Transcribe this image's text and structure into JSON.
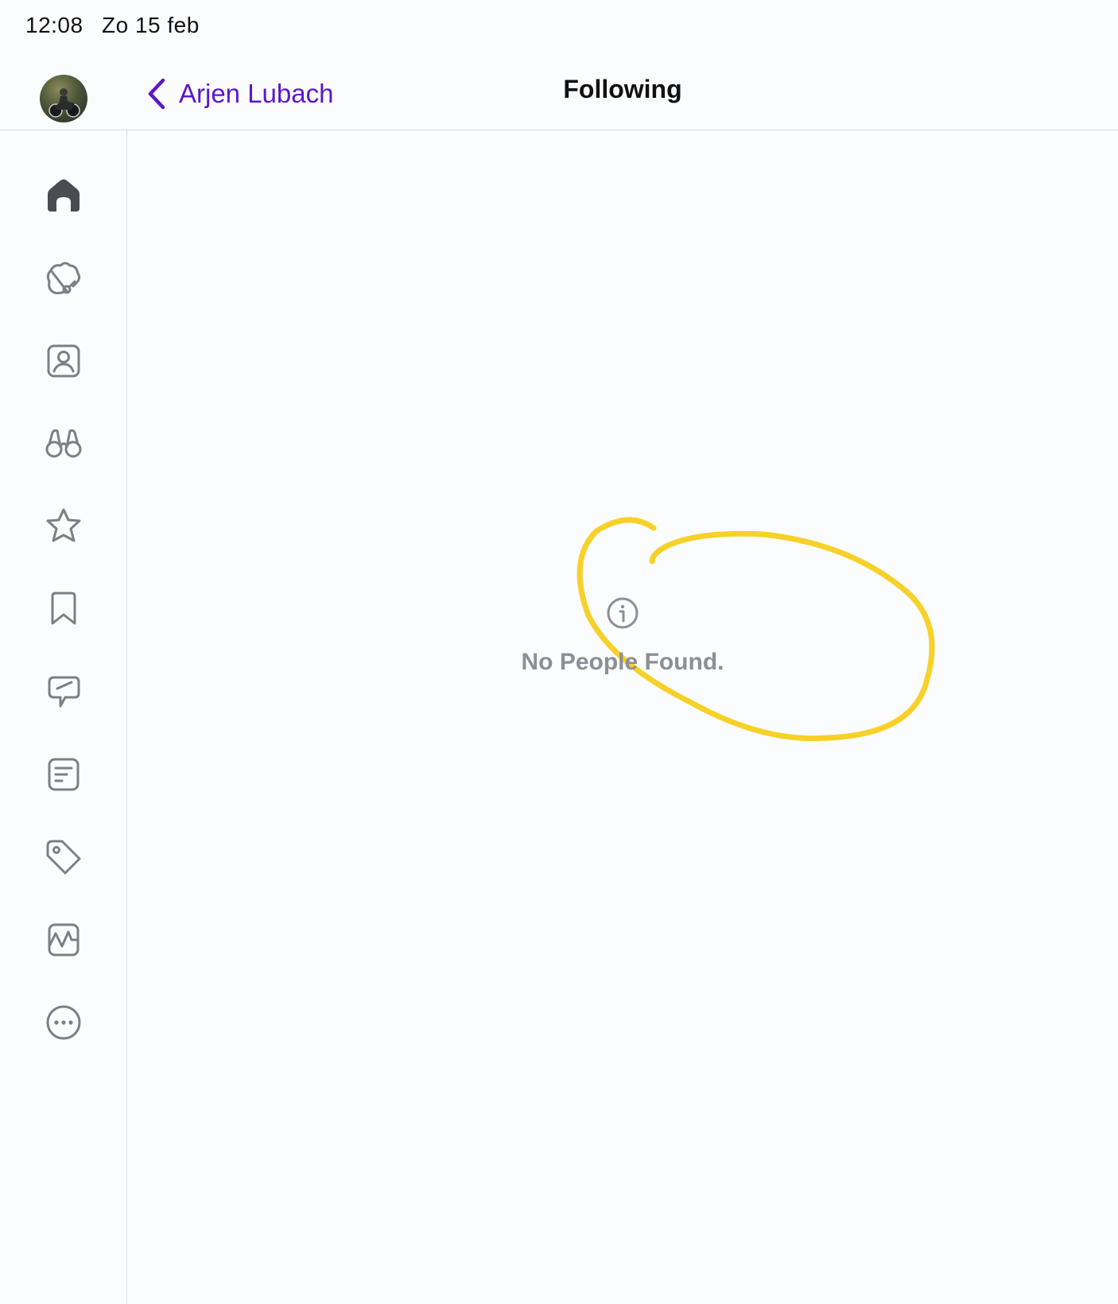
{
  "status_bar": {
    "time": "12:08",
    "date": "Zo 15 feb"
  },
  "nav": {
    "back_label": "Arjen Lubach",
    "title": "Following"
  },
  "sidebar": {
    "items": [
      {
        "icon": "home-icon",
        "active": true
      },
      {
        "icon": "explore-icon"
      },
      {
        "icon": "profile-icon"
      },
      {
        "icon": "binoculars-icon"
      },
      {
        "icon": "star-icon"
      },
      {
        "icon": "bookmark-icon"
      },
      {
        "icon": "messages-icon"
      },
      {
        "icon": "list-icon"
      },
      {
        "icon": "tag-icon"
      },
      {
        "icon": "activity-icon"
      },
      {
        "icon": "more-icon"
      }
    ]
  },
  "empty_state": {
    "icon": "info-icon",
    "message": "No People Found."
  },
  "colors": {
    "accent": "#5b17c8",
    "highlight": "#f7cf1d",
    "icon": "#7c7f86",
    "icon_active": "#4a4c52"
  }
}
